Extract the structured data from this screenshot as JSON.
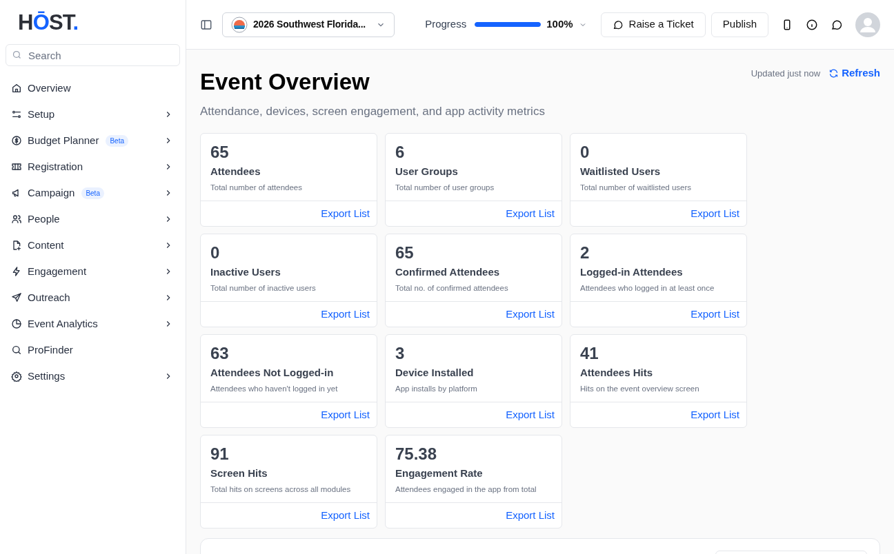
{
  "logo": [
    {
      "text": "H",
      "accent": false
    },
    {
      "text": "Ō",
      "accent": true
    },
    {
      "text": "ST",
      "accent": false
    },
    {
      "text": ".",
      "accent": true
    }
  ],
  "search": {
    "placeholder": "Search"
  },
  "sidebar": {
    "items": [
      {
        "label": "Overview",
        "has_submenu": false
      },
      {
        "label": "Setup",
        "has_submenu": true
      },
      {
        "label": "Budget Planner",
        "badge": "Beta",
        "has_submenu": true
      },
      {
        "label": "Registration",
        "has_submenu": true
      },
      {
        "label": "Campaign",
        "badge": "Beta",
        "has_submenu": true
      },
      {
        "label": "People",
        "has_submenu": true
      },
      {
        "label": "Content",
        "has_submenu": true
      },
      {
        "label": "Engagement",
        "has_submenu": true
      },
      {
        "label": "Outreach",
        "has_submenu": true
      },
      {
        "label": "Event Analytics",
        "has_submenu": true
      },
      {
        "label": "ProFinder",
        "has_submenu": false
      },
      {
        "label": "Settings",
        "has_submenu": true
      }
    ]
  },
  "topbar": {
    "event": "2026 Southwest Florida...",
    "progress_label": "Progress",
    "progress": {
      "level": 1.0
    },
    "progress_value": "100%",
    "buttons": [
      "Raise a Ticket",
      "Publish"
    ]
  },
  "page": {
    "title": "Event Overview",
    "subtitle": "Attendance, devices, screen engagement, and app activity metrics",
    "updated": "Updated just now",
    "refresh": "Refresh"
  },
  "cards": [
    {
      "value": "65",
      "title": "Attendees",
      "description": "Total number of attendees",
      "link": "Export List"
    },
    {
      "value": "6",
      "title": "User Groups",
      "description": "Total number of user groups",
      "link": "Export List"
    },
    {
      "value": "0",
      "title": "Waitlisted Users",
      "description": "Total number of waitlisted users",
      "link": "Export List"
    },
    {
      "value": "0",
      "title": "Inactive Users",
      "description": "Total number of inactive users",
      "link": "Export List"
    },
    {
      "value": "65",
      "title": "Confirmed Attendees",
      "description": "Total no. of confirmed attendees",
      "link": "Export List"
    },
    {
      "value": "2",
      "title": "Logged-in Attendees",
      "description": "Attendees who logged in at least once",
      "link": "Export List"
    },
    {
      "value": "63",
      "title": "Attendees Not Logged-in",
      "description": "Attendees who haven't logged in yet",
      "link": "Export List"
    },
    {
      "value": "3",
      "title": "Device Installed",
      "description": "App installs by platform",
      "link": "Export List"
    },
    {
      "value": "41",
      "title": "Attendees Hits",
      "description": "Hits on the event overview screen",
      "link": "Export List"
    },
    {
      "value": "91",
      "title": "Screen Hits",
      "description": "Total hits on screens across all modules",
      "link": "Export List"
    },
    {
      "value": "75.38",
      "title": "Engagement Rate",
      "description": "Attendees engaged in the app from total",
      "link": "Export List"
    }
  ]
}
